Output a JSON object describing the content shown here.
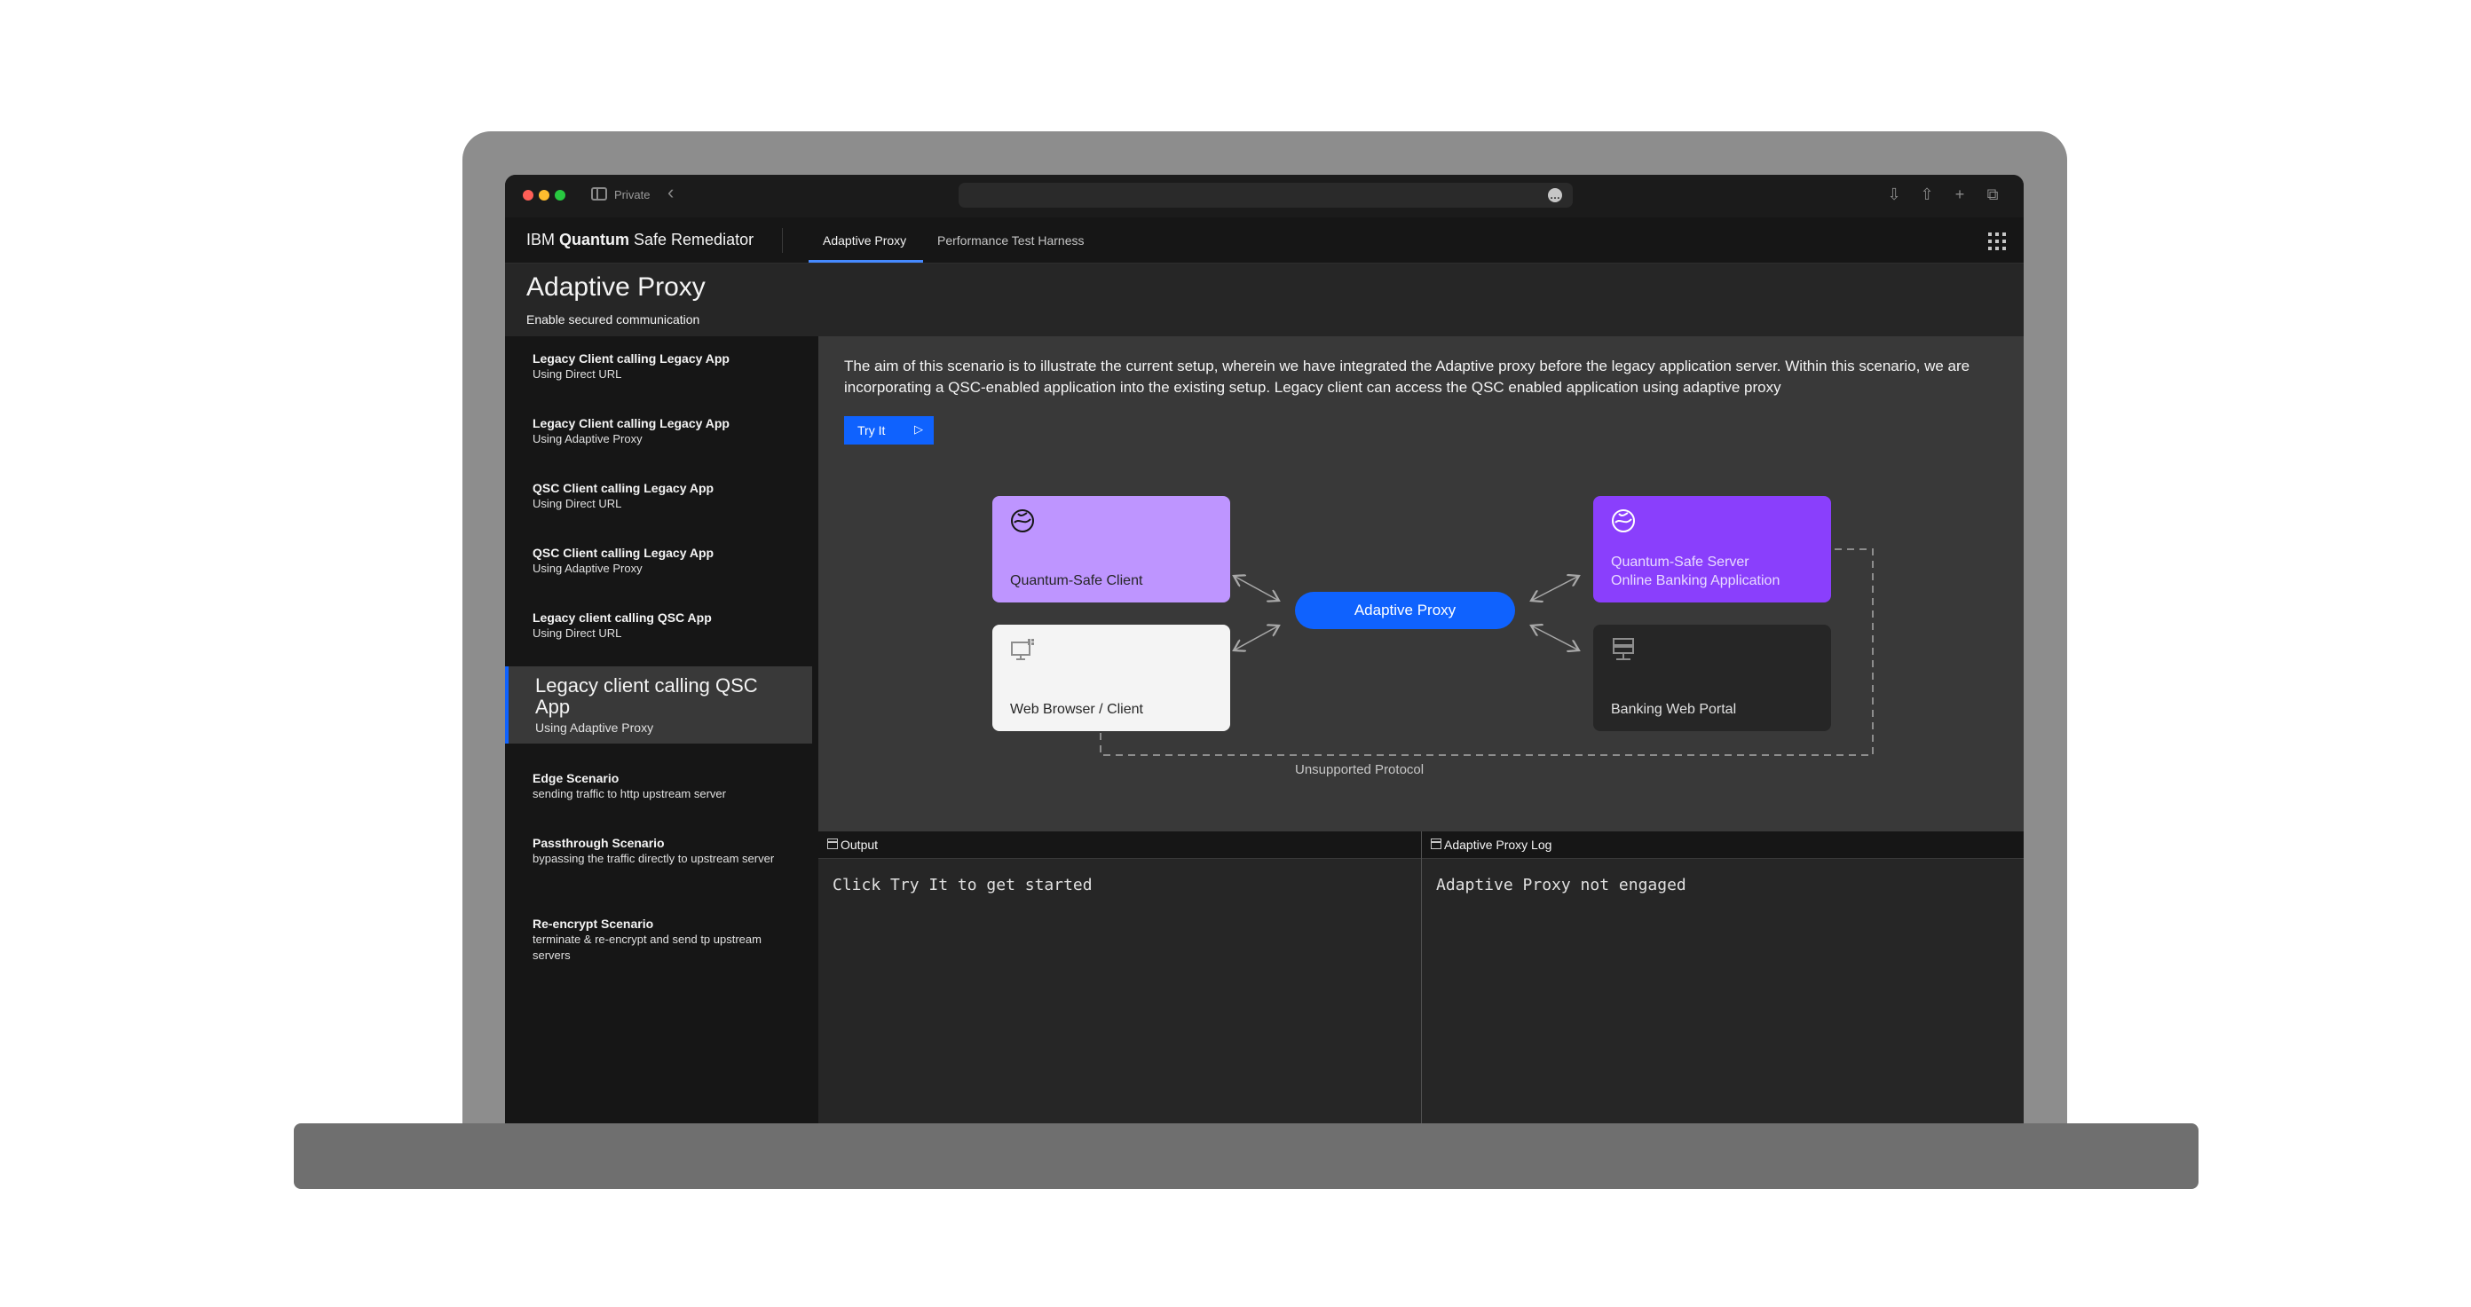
{
  "browser": {
    "private_label": "Private",
    "url_button": "…"
  },
  "header": {
    "brand_prefix": "IBM ",
    "brand_bold": "Quantum",
    "brand_suffix": " Safe Remediator",
    "tabs": [
      {
        "label": "Adaptive Proxy",
        "active": true
      },
      {
        "label": "Performance Test Harness",
        "active": false
      }
    ]
  },
  "page": {
    "title": "Adaptive Proxy",
    "subtitle": "Enable secured communication"
  },
  "scenarios": [
    {
      "title": "Legacy Client calling Legacy App",
      "subtitle": "Using Direct URL"
    },
    {
      "title": "Legacy Client calling Legacy App",
      "subtitle": "Using Adaptive Proxy"
    },
    {
      "title": "QSC Client calling Legacy App",
      "subtitle": "Using Direct URL"
    },
    {
      "title": "QSC Client calling Legacy App",
      "subtitle": "Using Adaptive Proxy"
    },
    {
      "title": "Legacy client calling QSC App",
      "subtitle": "Using Direct URL"
    },
    {
      "title": "Legacy client calling QSC App",
      "subtitle": "Using Adaptive Proxy",
      "active": true
    },
    {
      "title": "Edge Scenario",
      "subtitle": "sending traffic to http upstream server"
    },
    {
      "title": "Passthrough Scenario",
      "subtitle": "bypassing the traffic directly to upstream server"
    },
    {
      "title": "Re-encrypt Scenario",
      "subtitle": "terminate & re-encrypt and send tp upstream servers"
    }
  ],
  "main": {
    "description": "The aim of this scenario is to illustrate the current setup, wherein we have integrated the Adaptive proxy before the legacy application server. Within this scenario, we are incorporating a QSC-enabled application into the existing setup. Legacy client can access the QSC enabled application using adaptive proxy",
    "try_button": "Try It"
  },
  "diagram": {
    "qs_client": "Quantum-Safe Client",
    "web_client": "Web Browser / Client",
    "proxy": "Adaptive Proxy",
    "qs_server_line1": "Quantum-Safe Server",
    "qs_server_line2": "Online Banking Application",
    "banking_portal": "Banking Web Portal",
    "unsupported": "Unsupported Protocol",
    "colors": {
      "qs_client": "#be95ff",
      "web_client": "#f4f4f4",
      "qs_server": "#8a3ffc",
      "banking_portal": "#262626",
      "proxy": "#0f62fe"
    }
  },
  "output": {
    "title": "Output",
    "text": "Click Try It to get started"
  },
  "log": {
    "title": "Adaptive Proxy Log",
    "text": "Adaptive Proxy not engaged"
  }
}
